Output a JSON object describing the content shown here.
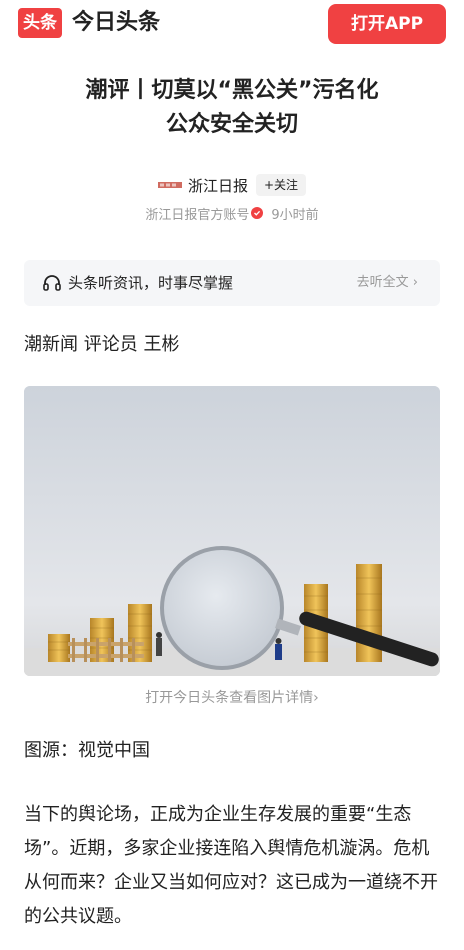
{
  "header": {
    "logo_badge": "头条",
    "app_name": "今日头条",
    "open_app": "打开APP"
  },
  "article": {
    "title_line1": "潮评丨切莫以“黑公关”污名化",
    "title_line2": "公众安全关切",
    "author": "浙江日报",
    "follow": "+关注",
    "account": "浙江日报官方账号",
    "time": "9小时前"
  },
  "listen": {
    "text": "头条听资讯，时事尽掌握",
    "link": "去听全文 ›"
  },
  "byline": "潮新闻 评论员 王彬",
  "image": {
    "caption": "打开今日头条查看图片详情›"
  },
  "source": "图源：视觉中国",
  "paragraph": "当下的舆论场，正成为企业生存发展的重要“生态场”。近期，多家企业接连陷入舆情危机漩涡。危机从何而来？企业又当如何应对？这已成为一道绕不开的公共议题。",
  "colors": {
    "brand_red": "#f04142",
    "muted_gray": "#999999"
  }
}
